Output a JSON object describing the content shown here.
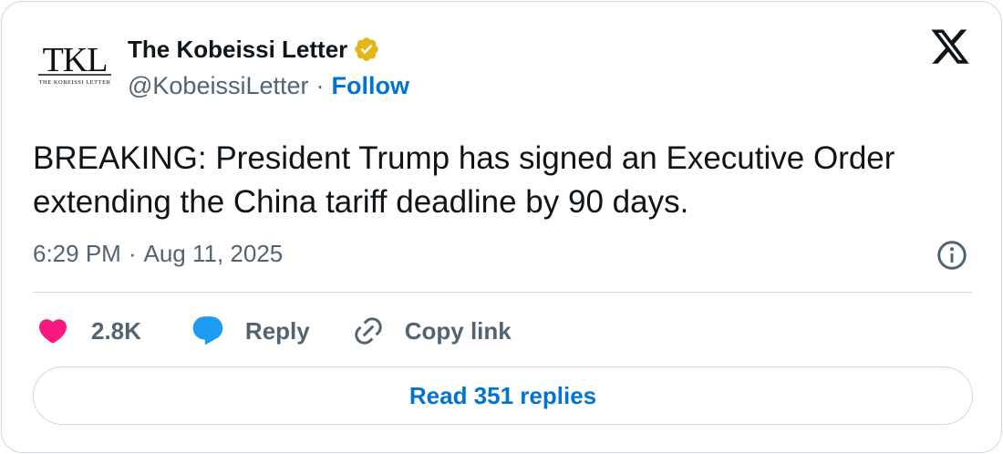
{
  "author": {
    "name": "The Kobeissi Letter",
    "handle": "@KobeissiLetter",
    "separator": "·",
    "follow_label": "Follow",
    "avatar_logo_text": "TKL",
    "avatar_logo_subtext": "THE KOBEISSI LETTER",
    "verified_icon": "verified-badge-icon",
    "verified_color": "#e2b719"
  },
  "platform": {
    "logo_icon": "x-logo-icon"
  },
  "tweet": {
    "text": "BREAKING: President Trump has signed an Executive Order extending the China tariff deadline by 90 days.",
    "time": "6:29 PM",
    "separator": "·",
    "date": "Aug 11, 2025",
    "info_icon": "info-icon"
  },
  "actions": {
    "like": {
      "icon": "heart-icon",
      "count": "2.8K",
      "color": "#f91880"
    },
    "reply": {
      "icon": "reply-bubble-icon",
      "label": "Reply",
      "color": "#1d9bf0"
    },
    "copy_link": {
      "icon": "link-icon",
      "label": "Copy link"
    }
  },
  "read_replies": {
    "label": "Read 351 replies"
  },
  "colors": {
    "accent": "#0074d4",
    "secondary_text": "#536471",
    "primary_text": "#0f1419",
    "border": "#cfd9de"
  }
}
